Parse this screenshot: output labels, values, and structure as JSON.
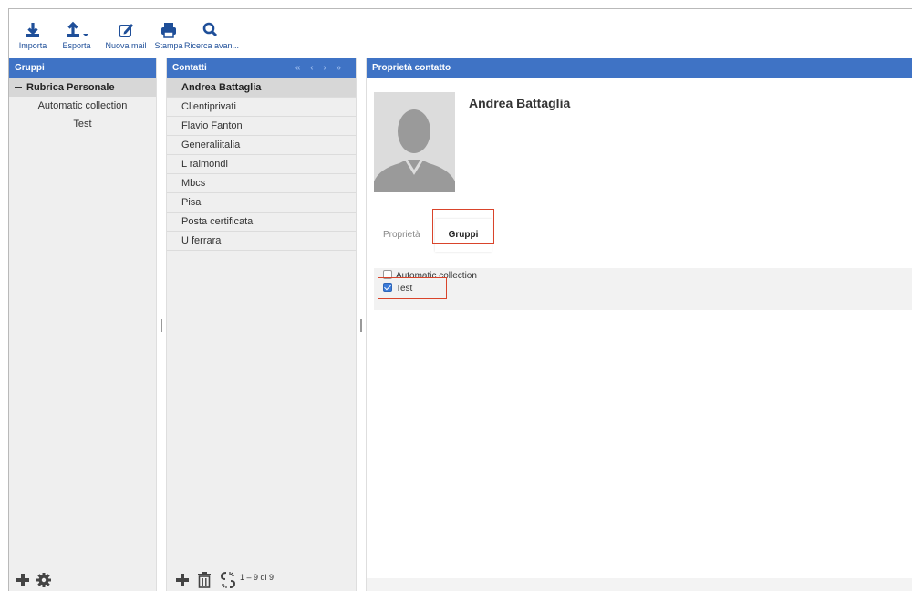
{
  "toolbar": {
    "import_label": "Importa",
    "export_label": "Esporta",
    "new_mail_label": "Nuova mail",
    "print_label": "Stampa",
    "advanced_search_label": "Ricerca avan..."
  },
  "groups_panel": {
    "title": "Gruppi",
    "root_label": "Rubrica Personale",
    "items": [
      {
        "label": "Automatic collection"
      },
      {
        "label": "Test"
      }
    ]
  },
  "contacts_panel": {
    "title": "Contatti",
    "pager": "« ‹ › »",
    "items": [
      {
        "label": "Andrea Battaglia",
        "selected": true
      },
      {
        "label": "Clientiprivati"
      },
      {
        "label": "Flavio Fanton"
      },
      {
        "label": "Generaliitalia"
      },
      {
        "label": "L raimondi"
      },
      {
        "label": "Mbcs"
      },
      {
        "label": "Pisa"
      },
      {
        "label": "Posta certificata"
      },
      {
        "label": "U ferrara"
      }
    ],
    "count": "1 – 9 di 9"
  },
  "details_panel": {
    "title": "Proprietà contatto",
    "contact_name": "Andrea Battaglia",
    "tabs": [
      {
        "label": "Proprietà",
        "active": false
      },
      {
        "label": "Gruppi",
        "active": true
      }
    ],
    "groups": [
      {
        "label": "Automatic collection",
        "checked": false
      },
      {
        "label": "Test",
        "checked": true
      }
    ]
  },
  "colors": {
    "header_blue": "#3f73c5",
    "icon_blue": "#1f4f99",
    "highlight_red": "#d9442b"
  }
}
